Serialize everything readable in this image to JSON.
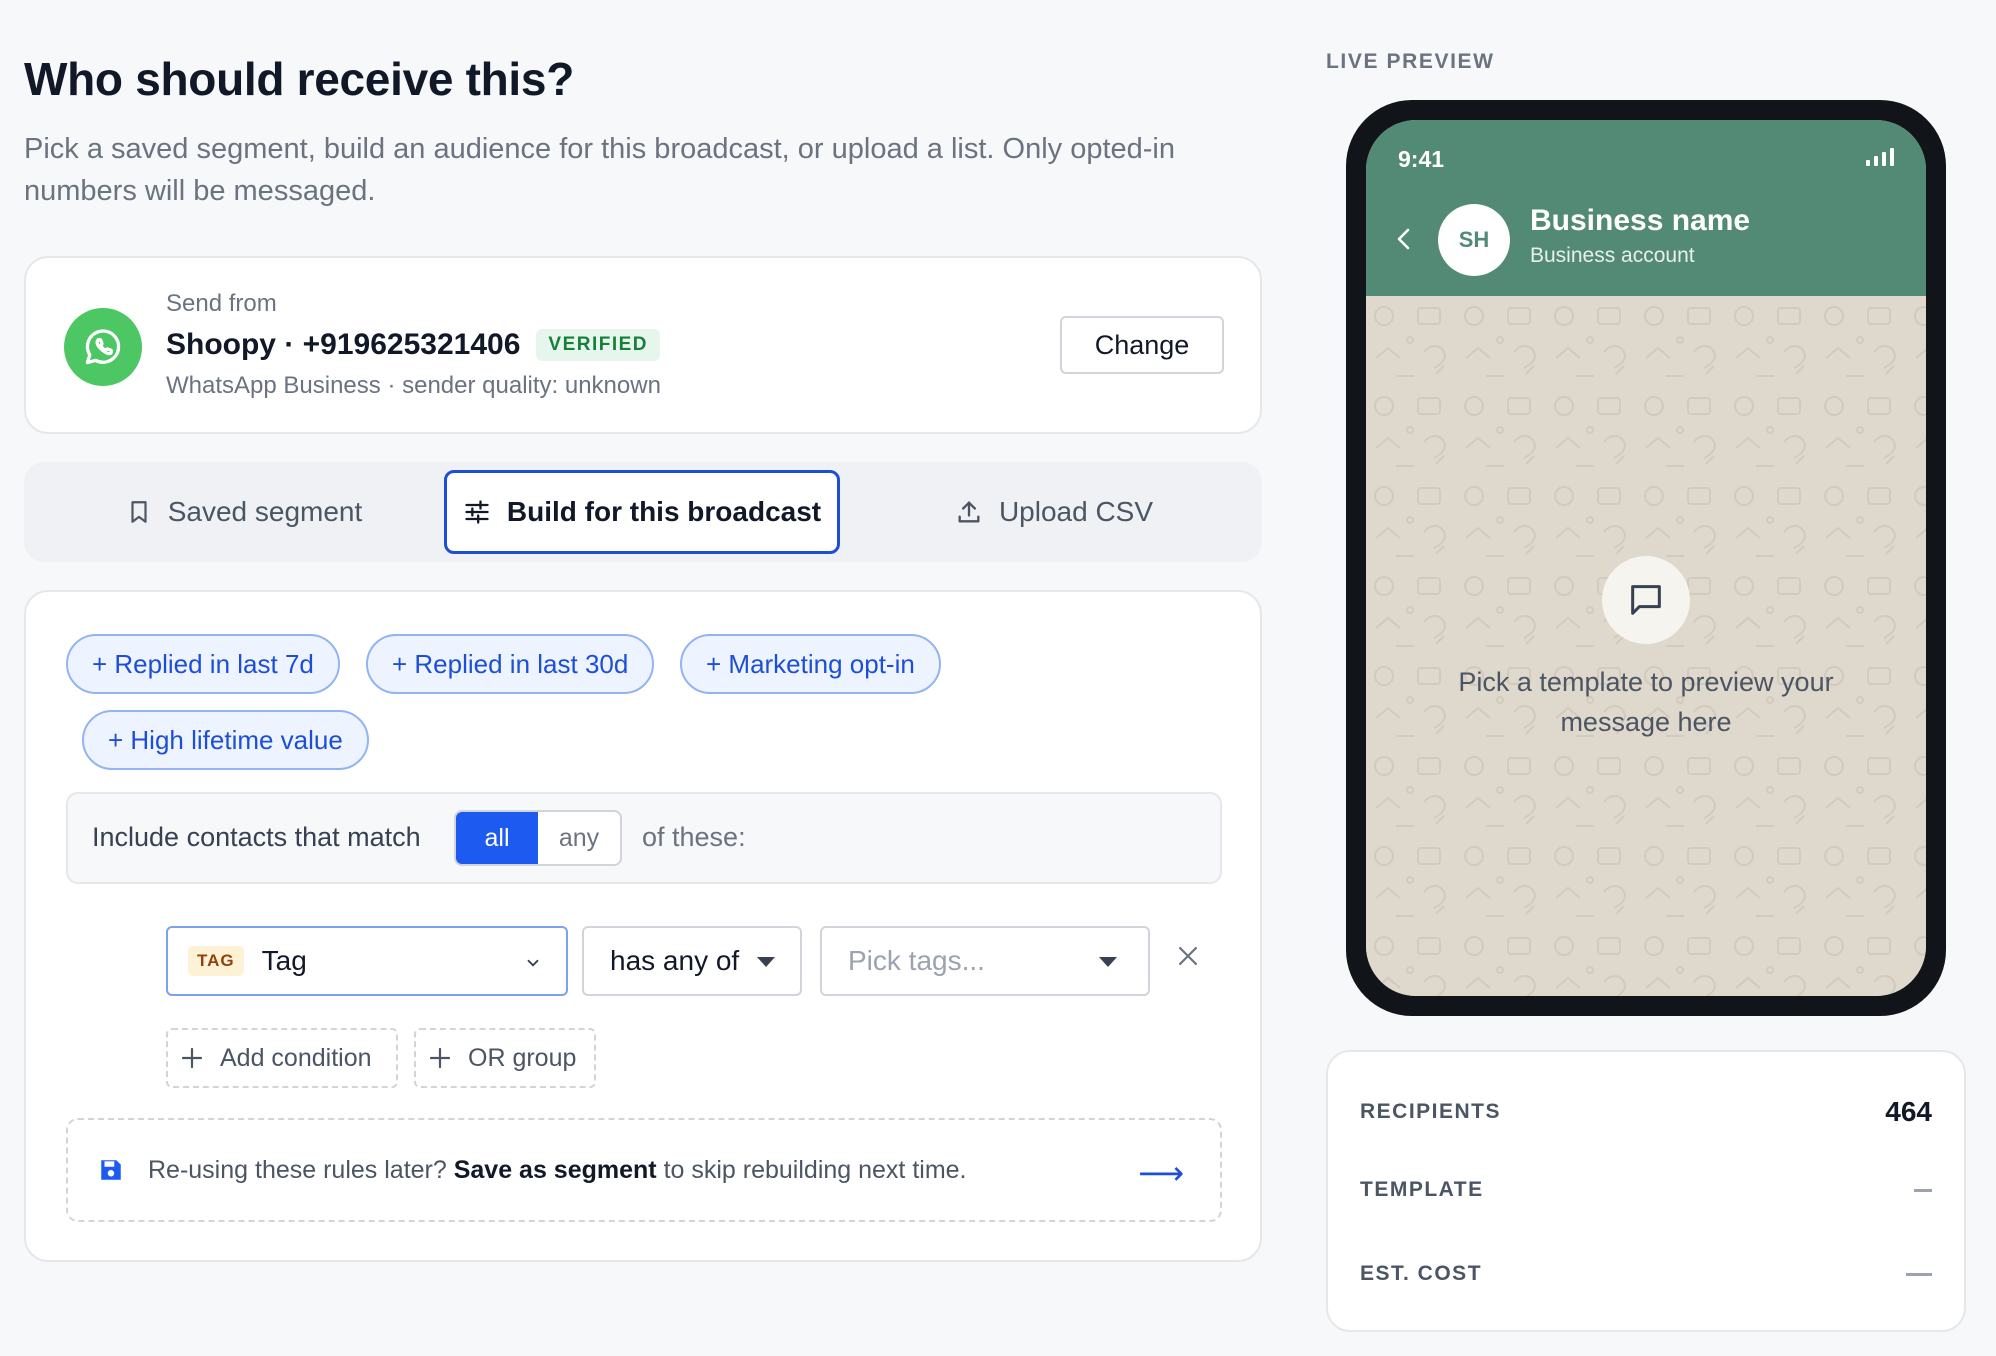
{
  "header": {
    "title": "Who should receive this?",
    "subtitle": "Pick a saved segment, build an audience for this broadcast, or upload a list. Only opted-in numbers will be messaged."
  },
  "sender": {
    "label": "Send from",
    "name": "Shoopy · +919625321406",
    "badge": "VERIFIED",
    "meta": "WhatsApp Business · sender quality: unknown",
    "change_label": "Change",
    "icon": "whatsapp-icon"
  },
  "tabs": [
    {
      "label": "Saved segment",
      "icon": "bookmark-icon",
      "active": false
    },
    {
      "label": "Build for this broadcast",
      "icon": "sliders-icon",
      "active": true
    },
    {
      "label": "Upload CSV",
      "icon": "upload-icon",
      "active": false
    }
  ],
  "builder": {
    "chips": [
      "+ Replied in last 7d",
      "+ Replied in last 30d",
      "+ Marketing opt-in",
      "+ High lifetime value"
    ],
    "match": {
      "prefix": "Include contacts that match",
      "options": [
        "all",
        "any"
      ],
      "selected": "all",
      "suffix": "of these:"
    },
    "condition": {
      "field_badge": "TAG",
      "field": "Tag",
      "operator": "has any of",
      "value_placeholder": "Pick tags..."
    },
    "add_condition_label": "Add condition",
    "or_group_label": "OR group",
    "save_tip": {
      "prefix": "Re-using these rules later? ",
      "action": "Save as segment",
      "suffix": " to skip rebuilding next time."
    }
  },
  "preview": {
    "label": "LIVE PREVIEW",
    "time": "9:41",
    "avatar_initials": "SH",
    "business_name": "Business name",
    "business_sub": "Business account",
    "empty_message": "Pick a template to preview your message here"
  },
  "summary": {
    "recipients_label": "RECIPIENTS",
    "recipients_value": "464",
    "template_label": "TEMPLATE",
    "cost_label": "EST. COST"
  },
  "colors": {
    "accent": "#1d4ed8",
    "whatsapp_green": "#4cc764",
    "wa_header": "#538a75",
    "verified_bg": "#e7f6ec"
  }
}
